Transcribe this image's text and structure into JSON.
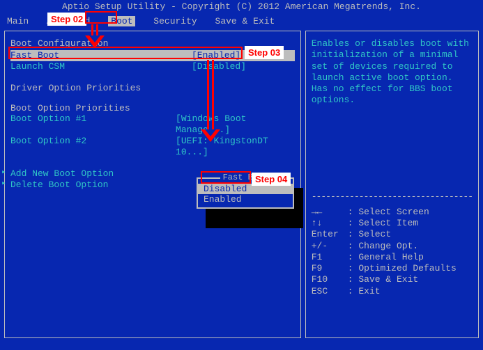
{
  "title": "Aptio Setup Utility - Copyright (C) 2012 American Megatrends, Inc.",
  "menu": {
    "items": [
      "Main",
      "Advanced",
      "Boot",
      "Security",
      "Save & Exit"
    ],
    "selected": "Boot"
  },
  "left": {
    "boot_config_header": "Boot Configuration",
    "fast_boot": {
      "label": "Fast Boot",
      "value": "[Enabled]"
    },
    "launch_csm": {
      "label": "Launch CSM",
      "value": "[Disabled]"
    },
    "driver_header": "Driver Option Priorities",
    "boot_header": "Boot Option Priorities",
    "boot1": {
      "label": "Boot Option #1",
      "value": "[Windows Boot Manage...]"
    },
    "boot2": {
      "label": "Boot Option #2",
      "value": "[UEFI: KingstonDT 10...]"
    },
    "add_boot": "Add New Boot Option",
    "delete_boot": "Delete Boot Option"
  },
  "popup": {
    "title": "Fast Boot",
    "options": [
      "Disabled",
      "Enabled"
    ],
    "selected": "Disabled"
  },
  "help": {
    "description": "Enables or disables boot with initialization of a minimal set of devices required to launch active boot option. Has no effect for BBS boot options.",
    "keys": [
      {
        "k": "→←",
        "d": ": Select Screen"
      },
      {
        "k": "↑↓",
        "d": ": Select Item"
      },
      {
        "k": "Enter",
        "d": ": Select"
      },
      {
        "k": "+/-",
        "d": ": Change Opt."
      },
      {
        "k": "F1",
        "d": ": General Help"
      },
      {
        "k": "F9",
        "d": ": Optimized Defaults"
      },
      {
        "k": "F10",
        "d": ": Save & Exit"
      },
      {
        "k": "ESC",
        "d": ": Exit"
      }
    ]
  },
  "annotations": {
    "step02": "Step 02",
    "step03": "Step 03",
    "step04": "Step 04"
  }
}
